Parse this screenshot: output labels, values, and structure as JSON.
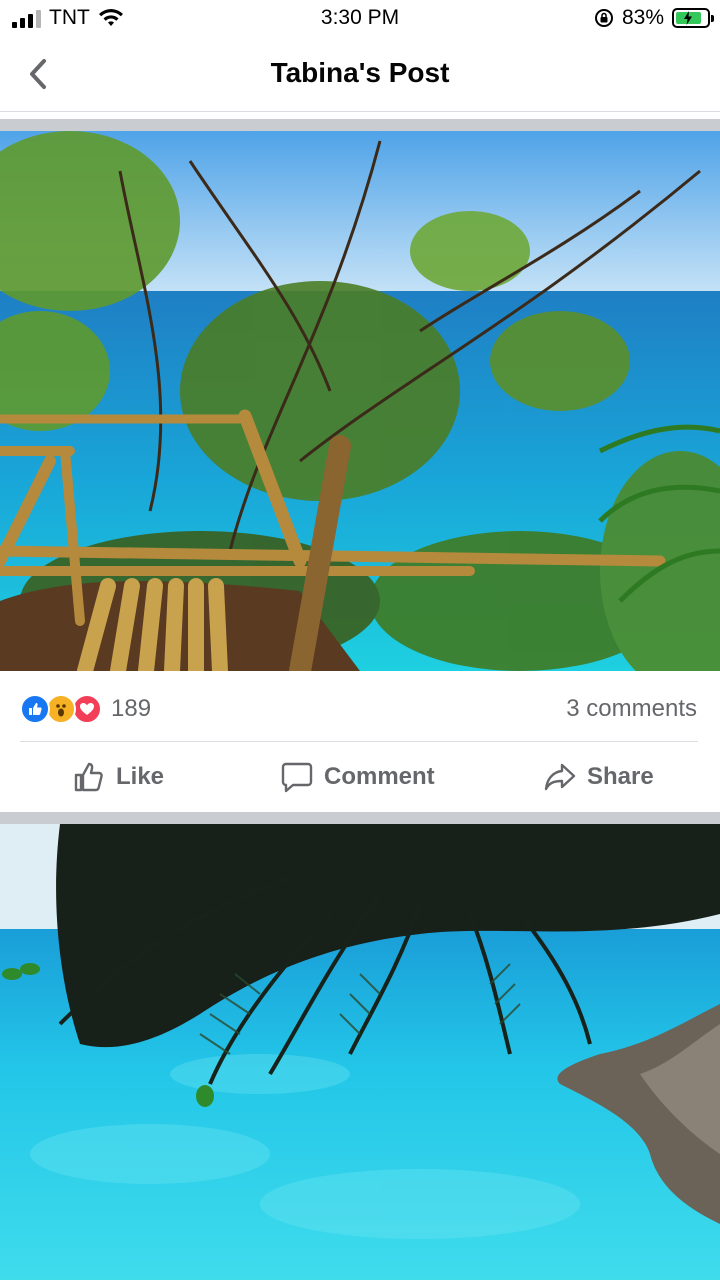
{
  "status_bar": {
    "carrier": "TNT",
    "time": "3:30 PM",
    "battery_percent": "83%",
    "battery_level": 0.83,
    "icons": [
      "signal-icon",
      "wifi-icon",
      "orientation-lock-icon",
      "battery-charging-icon"
    ]
  },
  "header": {
    "title": "Tabina's Post",
    "back_icon": "chevron-left-icon"
  },
  "post": {
    "photos": [
      {
        "description_icon": "photo-bamboo-platform-sea"
      },
      {
        "description_icon": "photo-palm-over-lagoon"
      }
    ],
    "reactions": {
      "types": [
        "like",
        "wow",
        "love"
      ],
      "count": "189"
    },
    "comments_label": "3 comments",
    "actions": {
      "like": "Like",
      "comment": "Comment",
      "share": "Share"
    }
  },
  "colors": {
    "facebook_blue": "#1877f2",
    "wow_yellow": "#f7b125",
    "love_red": "#f33e58",
    "secondary_text": "#65676b"
  }
}
